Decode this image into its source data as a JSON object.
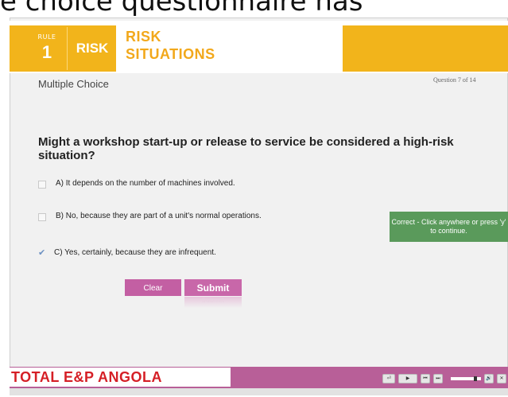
{
  "header_cut_text": "e choice questionnaire has",
  "banner": {
    "rule_word": "RULE",
    "rule_number": "1",
    "logo_text": "RISK",
    "title_line1": "RISK",
    "title_line2": "SITUATIONS"
  },
  "quiz": {
    "type_label": "Multiple Choice",
    "question_counter": "Question 7 of 14",
    "question": "Might a workshop start-up or release to service be considered a high-risk situation?",
    "options": [
      {
        "label": "A) It depends on the number of machines involved.",
        "checked": false
      },
      {
        "label": "B) No, because they are part of a unit's normal operations.",
        "checked": false
      },
      {
        "label": "C) Yes, certainly, because they are infrequent.",
        "checked": true
      }
    ],
    "feedback_line1": "Correct - Click anywhere or press 'y'",
    "feedback_line2": "to continue.",
    "clear_label": "Clear",
    "submit_label": "Submit",
    "submit_reflection": "Submit"
  },
  "footer": {
    "brand": "TOTAL E&P ANGOLA",
    "controls": [
      "⏎",
      "▶",
      "⏮",
      "⏭",
      "🔊",
      "✕"
    ],
    "progress_fraction": 0.82
  },
  "colors": {
    "accent_yellow": "#f2b41b",
    "footer_pink": "#b85f98",
    "button_pink": "#c35fa3",
    "feedback_green": "#5a9a5b",
    "brand_red": "#d51f26"
  }
}
